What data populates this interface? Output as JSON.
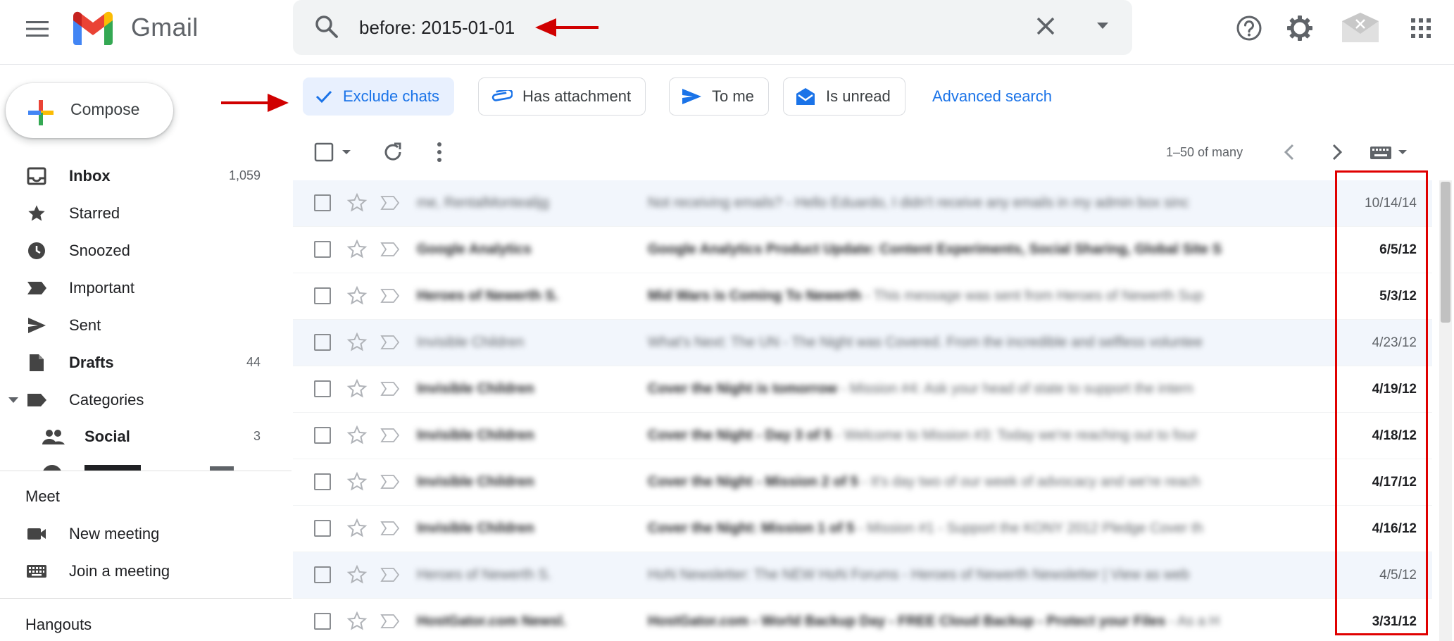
{
  "app": {
    "logo_text": "Gmail",
    "colors": {
      "accent": "#1a73e8",
      "annotation": "#d00000",
      "chip_active_bg": "#e8f0fe"
    }
  },
  "search": {
    "query": "before: 2015-01-01",
    "icon": "search-icon",
    "clear_icon": "close-icon",
    "options_icon": "caret-down-icon"
  },
  "header_icons": [
    "help-icon",
    "gear-icon",
    "account-icon",
    "apps-grid-icon"
  ],
  "compose": {
    "label": "Compose"
  },
  "sidebar": {
    "items": [
      {
        "label": "Inbox",
        "count": "1,059",
        "icon": "inbox-icon",
        "bold": true
      },
      {
        "label": "Starred",
        "count": "",
        "icon": "star-icon"
      },
      {
        "label": "Snoozed",
        "count": "",
        "icon": "clock-icon"
      },
      {
        "label": "Important",
        "count": "",
        "icon": "important-icon"
      },
      {
        "label": "Sent",
        "count": "",
        "icon": "send-icon"
      },
      {
        "label": "Drafts",
        "count": "44",
        "icon": "draft-icon",
        "bold": true
      },
      {
        "label": "Categories",
        "count": "",
        "icon": "label-icon"
      },
      {
        "label": "Social",
        "count": "3",
        "icon": "people-icon",
        "bold": true
      }
    ]
  },
  "meet": {
    "title": "Meet",
    "new_meeting": "New meeting",
    "join_meeting": "Join a meeting"
  },
  "hangouts": {
    "title": "Hangouts"
  },
  "chips": [
    {
      "label": "Exclude chats",
      "icon": "check-icon",
      "active": true
    },
    {
      "label": "Has attachment",
      "icon": "attachment-icon",
      "active": false
    },
    {
      "label": "To me",
      "icon": "send-icon",
      "active": false
    },
    {
      "label": "Is unread",
      "icon": "mail-unread-icon",
      "active": false
    }
  ],
  "advanced_search": "Advanced search",
  "toolbar": {
    "pagination": "1–50 of many",
    "icons": [
      "select-checkbox-icon",
      "refresh-icon",
      "more-vert-icon",
      "prev-page-icon",
      "next-page-icon",
      "keyboard-icon"
    ]
  },
  "emails": [
    {
      "sender": "me, RentalMontealijg",
      "subject": "Not receiving emails?",
      "snippet": " - Hello Eduardo, I didn't receive any emails in my admin box sinc",
      "date": "10/14/14",
      "unread": false
    },
    {
      "sender": "Google Analytics",
      "subject": "Google Analytics Product Update: Content Experiments, Social Sharing, Global Site S",
      "snippet": "",
      "date": "6/5/12",
      "unread": true
    },
    {
      "sender": "Heroes of Newerth S.",
      "subject": "Mid Wars is Coming To Newerth",
      "snippet": " - This message was sent from Heroes of Newerth Sup",
      "date": "5/3/12",
      "unread": true
    },
    {
      "sender": "Invisible Children",
      "subject": "What's Next: The UN",
      "snippet": " - The Night was Covered. From the incredible and selfless voluntee",
      "date": "4/23/12",
      "unread": false
    },
    {
      "sender": "Invisible Children",
      "subject": "Cover the Night is tomorrow",
      "snippet": " - Mission #4: Ask your head of state to support the intern",
      "date": "4/19/12",
      "unread": true
    },
    {
      "sender": "Invisible Children",
      "subject": "Cover the Night - Day 3 of 5",
      "snippet": " - Welcome to Mission #3: Today we're reaching out to four",
      "date": "4/18/12",
      "unread": true
    },
    {
      "sender": "Invisible Children",
      "subject": "Cover the Night - Mission 2 of 5",
      "snippet": " - It's day two of our week of advocacy and we're reach",
      "date": "4/17/12",
      "unread": true
    },
    {
      "sender": "Invisible Children",
      "subject": "Cover the Night: Mission 1 of 5",
      "snippet": " - Mission #1 - Support the KONY 2012 Pledge Cover th",
      "date": "4/16/12",
      "unread": true
    },
    {
      "sender": "Heroes of Newerth S.",
      "subject": "HoN Newsletter: The NEW HoN Forums",
      "snippet": " - Heroes of Newerth Newsletter | View as web",
      "date": "4/5/12",
      "unread": false
    },
    {
      "sender": "HostGator.com Newsl.",
      "subject": "HostGator.com - World Backup Day - FREE Cloud Backup - Protect your Files",
      "snippet": " - As a H",
      "date": "3/31/12",
      "unread": true
    }
  ]
}
